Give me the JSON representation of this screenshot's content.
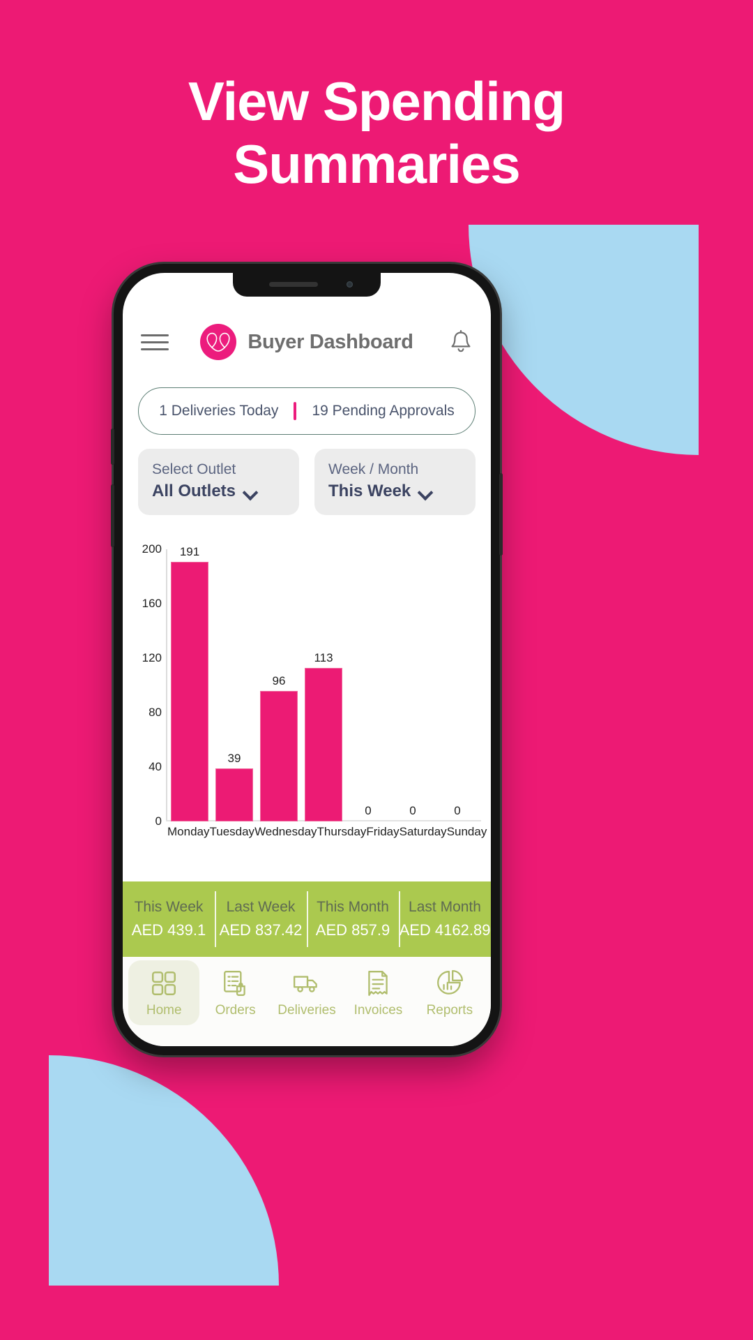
{
  "promo": {
    "headline_line1": "View Spending",
    "headline_line2": "Summaries",
    "background_color": "#ed1a74",
    "accent_shape_color": "#a9d9f2"
  },
  "app": {
    "header": {
      "menu_icon": "hamburger-menu-icon",
      "brand_logo_icon": "brand-w-loops-icon",
      "title": "Buyer Dashboard",
      "notification_icon": "bell-icon"
    },
    "status_pill": {
      "deliveries_today": "1 Deliveries Today",
      "pending_approvals": "19 Pending Approvals",
      "divider_color": "#ec1c7d"
    },
    "filters": [
      {
        "label": "Select Outlet",
        "value": "All Outlets",
        "chevron_icon": "chevron-down-icon"
      },
      {
        "label": "Week / Month",
        "value": "This Week",
        "chevron_icon": "chevron-down-icon"
      }
    ],
    "summary_bar": {
      "background_color": "#abc94f",
      "cells": [
        {
          "title": "This Week",
          "value": "AED 439.1"
        },
        {
          "title": "Last Week",
          "value": "AED 837.42"
        },
        {
          "title": "This Month",
          "value": "AED 857.9"
        },
        {
          "title": "Last Month",
          "value": "AED 4162.89"
        }
      ]
    },
    "bottom_nav": {
      "active_color": "#b0bd6d",
      "items": [
        {
          "label": "Home",
          "icon": "grid-home-icon",
          "active": true
        },
        {
          "label": "Orders",
          "icon": "orders-list-icon",
          "active": false
        },
        {
          "label": "Deliveries",
          "icon": "delivery-truck-icon",
          "active": false
        },
        {
          "label": "Invoices",
          "icon": "invoice-receipt-icon",
          "active": false
        },
        {
          "label": "Reports",
          "icon": "report-chart-icon",
          "active": false
        }
      ]
    }
  },
  "chart_data": {
    "type": "bar",
    "title": "",
    "xlabel": "",
    "ylabel": "",
    "categories": [
      "Monday",
      "Tuesday",
      "Wednesday",
      "Thursday",
      "Friday",
      "Saturday",
      "Sunday"
    ],
    "values": [
      191,
      39,
      96,
      113,
      0,
      0,
      0
    ],
    "value_labels": [
      "191",
      "39",
      "96",
      "113",
      "0",
      "0",
      "0"
    ],
    "yticks": [
      0,
      40,
      80,
      120,
      160,
      200
    ],
    "ytick_labels": [
      "0",
      "40",
      "80",
      "120",
      "160",
      "200"
    ],
    "ylim": [
      0,
      200
    ],
    "grid": false,
    "legend": "none",
    "bar_color": "#ec1b74",
    "bar_border_color": "#f06a9d"
  }
}
